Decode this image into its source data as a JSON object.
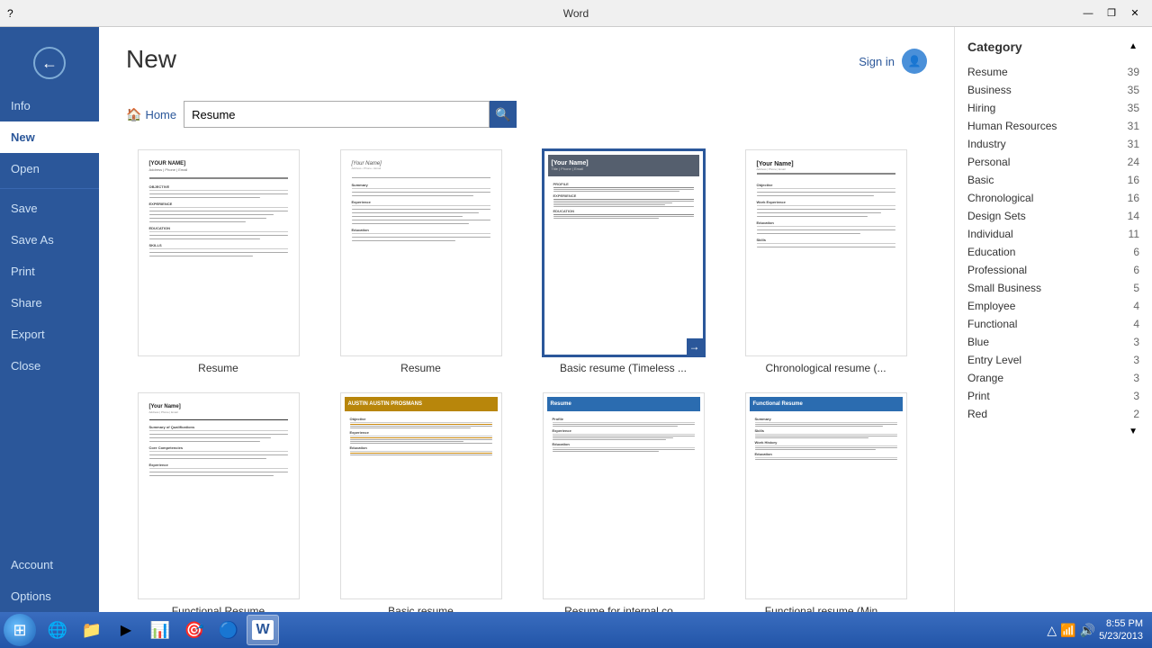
{
  "titlebar": {
    "title": "Word",
    "help": "?",
    "minimize": "—",
    "restore": "❐",
    "close": "✕"
  },
  "sidebar": {
    "back_label": "←",
    "items": [
      {
        "id": "info",
        "label": "Info",
        "active": false
      },
      {
        "id": "new",
        "label": "New",
        "active": true
      },
      {
        "id": "open",
        "label": "Open",
        "active": false
      },
      {
        "id": "save",
        "label": "Save",
        "active": false
      },
      {
        "id": "save_as",
        "label": "Save As",
        "active": false
      },
      {
        "id": "print",
        "label": "Print",
        "active": false
      },
      {
        "id": "share",
        "label": "Share",
        "active": false
      },
      {
        "id": "export",
        "label": "Export",
        "active": false
      },
      {
        "id": "close_doc",
        "label": "Close",
        "active": false
      }
    ],
    "bottom_items": [
      {
        "id": "account",
        "label": "Account"
      },
      {
        "id": "options",
        "label": "Options"
      }
    ]
  },
  "page": {
    "title": "New",
    "search_placeholder": "Resume",
    "home_label": "Home"
  },
  "templates": [
    {
      "id": "resume1",
      "label": "Resume",
      "style": "basic1"
    },
    {
      "id": "resume2",
      "label": "Resume",
      "style": "basic2"
    },
    {
      "id": "resume3",
      "label": "Basic resume (Timeless ...",
      "style": "timeless",
      "selected": true,
      "arrow": "→"
    },
    {
      "id": "resume4",
      "label": "Chronological resume (...",
      "style": "chron"
    },
    {
      "id": "resume5",
      "label": "Functional Resume",
      "style": "functional"
    },
    {
      "id": "resume6",
      "label": "Basic resume",
      "style": "colorful"
    },
    {
      "id": "resume7",
      "label": "Resume for internal co...",
      "style": "blue1"
    },
    {
      "id": "resume8",
      "label": "Functional resume (Min...",
      "style": "blue2"
    }
  ],
  "categories": {
    "title": "Category",
    "items": [
      {
        "id": "resume",
        "label": "Resume",
        "count": 39
      },
      {
        "id": "business",
        "label": "Business",
        "count": 35
      },
      {
        "id": "hiring",
        "label": "Hiring",
        "count": 35
      },
      {
        "id": "human_resources",
        "label": "Human Resources",
        "count": 31
      },
      {
        "id": "industry",
        "label": "Industry",
        "count": 31
      },
      {
        "id": "personal",
        "label": "Personal",
        "count": 24
      },
      {
        "id": "basic",
        "label": "Basic",
        "count": 16
      },
      {
        "id": "chronological",
        "label": "Chronological",
        "count": 16
      },
      {
        "id": "design_sets",
        "label": "Design Sets",
        "count": 14
      },
      {
        "id": "individual",
        "label": "Individual",
        "count": 11
      },
      {
        "id": "education",
        "label": "Education",
        "count": 6
      },
      {
        "id": "professional",
        "label": "Professional",
        "count": 6
      },
      {
        "id": "small_business",
        "label": "Small Business",
        "count": 5
      },
      {
        "id": "employee",
        "label": "Employee",
        "count": 4
      },
      {
        "id": "functional",
        "label": "Functional",
        "count": 4
      },
      {
        "id": "blue",
        "label": "Blue",
        "count": 3
      },
      {
        "id": "entry_level",
        "label": "Entry Level",
        "count": 3
      },
      {
        "id": "orange",
        "label": "Orange",
        "count": 3
      },
      {
        "id": "print",
        "label": "Print",
        "count": 3
      },
      {
        "id": "red",
        "label": "Red",
        "count": 2
      }
    ]
  },
  "taskbar": {
    "start_label": "⊞",
    "items": [
      {
        "id": "ie",
        "label": "IE",
        "icon": "🌐"
      },
      {
        "id": "explorer",
        "label": "Explorer",
        "icon": "📁"
      },
      {
        "id": "media",
        "label": "Media",
        "icon": "▶"
      },
      {
        "id": "app5",
        "label": "App",
        "icon": "📊"
      },
      {
        "id": "app6",
        "label": "App",
        "icon": "🎯"
      },
      {
        "id": "chrome",
        "label": "Chrome",
        "icon": "🔵"
      },
      {
        "id": "word",
        "label": "Word",
        "icon": "W",
        "active": true
      }
    ],
    "tray": {
      "time": "8:55 PM",
      "date": "5/23/2013"
    }
  },
  "signin": {
    "label": "Sign in"
  }
}
